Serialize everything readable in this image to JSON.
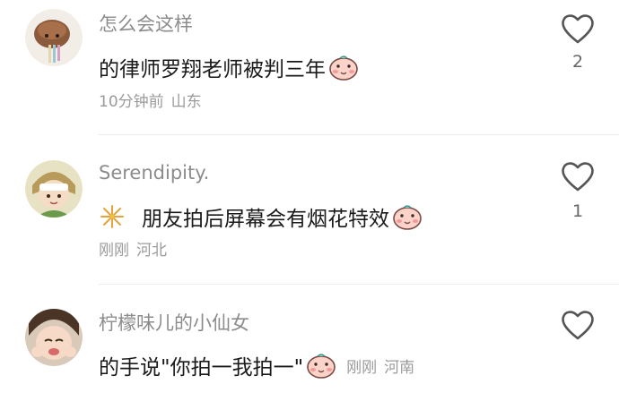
{
  "comments": [
    {
      "username": "怎么会这样",
      "text": "的律师罗翔老师被判三年",
      "time": "10分钟前",
      "location": "山东",
      "likes": "2",
      "emoji": "blushing-face-icon"
    },
    {
      "username": "Serendipity.",
      "text": "朋友拍后屏幕会有烟花特效",
      "time": "刚刚",
      "location": "河北",
      "likes": "1",
      "emoji": "blushing-face-icon",
      "prefix_icon": "firework-icon"
    },
    {
      "username": "柠檬味儿的小仙女",
      "text": "的手说\"你拍一我拍一\"",
      "time": "刚刚",
      "location": "河南",
      "emoji": "blushing-face-icon"
    }
  ],
  "colors": {
    "username": "#8c8c8c",
    "text": "#1a1a1a",
    "meta": "#9a9a9a",
    "divider": "#ececec",
    "heart_outline": "#555555"
  }
}
